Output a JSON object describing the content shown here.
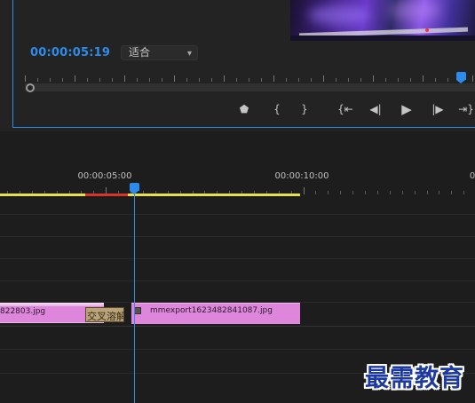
{
  "monitor": {
    "timecode": "00:00:05:19",
    "fit_select": {
      "value": "适合",
      "chevron": "▾"
    },
    "controls": [
      {
        "name": "add-marker-button",
        "icon": "marker-icon",
        "glyph": "⬟"
      },
      {
        "name": "mark-in-button",
        "icon": "mark-in-icon",
        "glyph": "{"
      },
      {
        "name": "mark-out-button",
        "icon": "mark-out-icon",
        "glyph": "}"
      },
      {
        "name": "go-to-in-button",
        "icon": "go-to-in-icon",
        "glyph": "{⇤"
      },
      {
        "name": "step-back-button",
        "icon": "step-back-icon",
        "glyph": "◀|"
      },
      {
        "name": "play-button",
        "icon": "play-icon",
        "glyph": "▶"
      },
      {
        "name": "step-forward-button",
        "icon": "step-forward-icon",
        "glyph": "|▶"
      },
      {
        "name": "go-to-out-button",
        "icon": "go-to-out-icon",
        "glyph": "⇥}"
      }
    ]
  },
  "timeline": {
    "ruler_labels": [
      "00:00:05:00",
      "00:00:10:00",
      "0"
    ],
    "clips": {
      "clip_a_label": "822803.jpg",
      "transition_label": "交叉溶解",
      "clip_b_label": "mmexport1623482841087.jpg"
    },
    "colors": {
      "playhead": "#2d8ceb",
      "work_area": "#e8e04a",
      "render_bar": "#d8342a",
      "clip": "#de86dc",
      "transition": "#b8a37a"
    }
  },
  "watermark": "最需教育"
}
